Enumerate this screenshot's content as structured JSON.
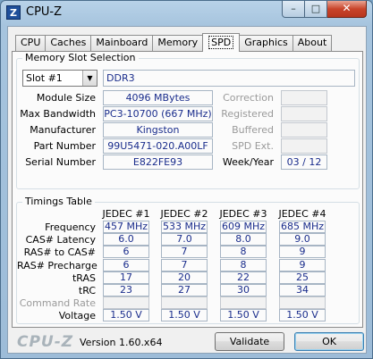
{
  "window": {
    "title": "CPU-Z",
    "icon_letter": "Z",
    "minimize": "–",
    "maximize": "□",
    "close": "✕"
  },
  "tabs": [
    {
      "label": "CPU",
      "active": false
    },
    {
      "label": "Caches",
      "active": false
    },
    {
      "label": "Mainboard",
      "active": false
    },
    {
      "label": "Memory",
      "active": false
    },
    {
      "label": "SPD",
      "active": true
    },
    {
      "label": "Graphics",
      "active": false
    },
    {
      "label": "About",
      "active": false
    }
  ],
  "memory_slot": {
    "group_label": "Memory Slot Selection",
    "slot": "Slot #1",
    "type": "DDR3",
    "module_size_label": "Module Size",
    "module_size": "4096 MBytes",
    "max_bandwidth_label": "Max Bandwidth",
    "max_bandwidth": "PC3-10700 (667 MHz)",
    "manufacturer_label": "Manufacturer",
    "manufacturer": "Kingston",
    "part_number_label": "Part Number",
    "part_number": "99U5471-020.A00LF",
    "serial_number_label": "Serial Number",
    "serial_number": "E822FE93",
    "correction_label": "Correction",
    "correction": "",
    "registered_label": "Registered",
    "registered": "",
    "buffered_label": "Buffered",
    "buffered": "",
    "spd_ext_label": "SPD Ext.",
    "spd_ext": "",
    "week_year_label": "Week/Year",
    "week_year": "03 / 12"
  },
  "timings": {
    "group_label": "Timings Table",
    "columns": [
      "JEDEC #1",
      "JEDEC #2",
      "JEDEC #3",
      "JEDEC #4"
    ],
    "rows": [
      {
        "label": "Frequency",
        "enabled": true,
        "values": [
          "457 MHz",
          "533 MHz",
          "609 MHz",
          "685 MHz"
        ]
      },
      {
        "label": "CAS# Latency",
        "enabled": true,
        "values": [
          "6.0",
          "7.0",
          "8.0",
          "9.0"
        ]
      },
      {
        "label": "RAS# to CAS#",
        "enabled": true,
        "values": [
          "6",
          "7",
          "8",
          "9"
        ]
      },
      {
        "label": "RAS# Precharge",
        "enabled": true,
        "values": [
          "6",
          "7",
          "8",
          "9"
        ]
      },
      {
        "label": "tRAS",
        "enabled": true,
        "values": [
          "17",
          "20",
          "22",
          "25"
        ]
      },
      {
        "label": "tRC",
        "enabled": true,
        "values": [
          "23",
          "27",
          "30",
          "34"
        ]
      },
      {
        "label": "Command Rate",
        "enabled": false,
        "values": [
          "",
          "",
          "",
          ""
        ]
      },
      {
        "label": "Voltage",
        "enabled": true,
        "values": [
          "1.50 V",
          "1.50 V",
          "1.50 V",
          "1.50 V"
        ]
      }
    ]
  },
  "footer": {
    "brand": "CPU-Z",
    "version": "Version 1.60.x64",
    "validate_label": "Validate",
    "ok_label": "OK"
  }
}
